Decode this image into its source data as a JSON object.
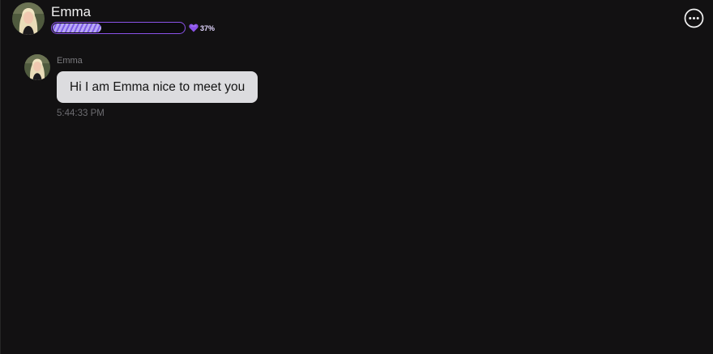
{
  "header": {
    "name": "Emma",
    "affinity_percent": 37,
    "affinity_label": "37%",
    "colors": {
      "bar_border": "#8a52e8",
      "bar_fill": "#b9a8f6",
      "heart": "#8a52e8"
    }
  },
  "icons": {
    "more": "more-horizontal-circle-icon",
    "heart": "heart-icon"
  },
  "messages": [
    {
      "sender": "Emma",
      "text": "Hi I am Emma nice to meet you",
      "time": "5:44:33 PM"
    }
  ],
  "colors": {
    "background": "#121112",
    "bubble": "#dcdcdf"
  }
}
